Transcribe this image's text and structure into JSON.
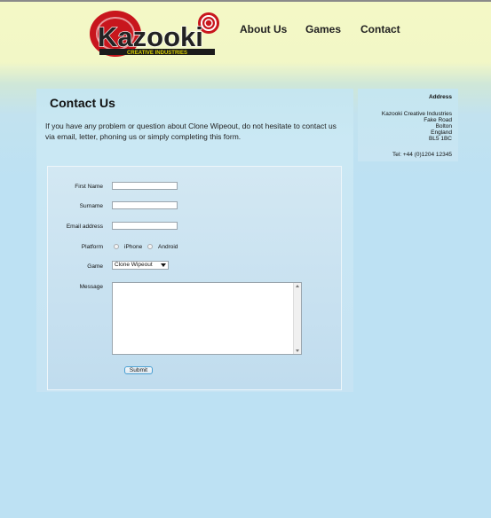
{
  "brand": {
    "logo_text": "Kazooki",
    "logo_subtext": "CREATIVE INDUSTRIES",
    "colors": {
      "logo_red": "#c8161d",
      "logo_dark": "#222222",
      "logo_yellow": "#d8d000"
    }
  },
  "nav": [
    {
      "label": "About Us"
    },
    {
      "label": "Games"
    },
    {
      "label": "Contact"
    }
  ],
  "content": {
    "title": "Contact Us",
    "intro": "If you have any problem or question about Clone Wipeout, do not hesitate to contact us via email, letter, phoning us or simply completing this form."
  },
  "form": {
    "first_name_label": "First Name",
    "first_name_value": "",
    "surname_label": "Surname",
    "surname_value": "",
    "email_label": "Email address",
    "email_value": "",
    "platform_label": "Platform",
    "platform_options": [
      "iPhone",
      "Android"
    ],
    "game_label": "Game",
    "game_selected": "Clone Wipeout",
    "message_label": "Message",
    "message_value": "",
    "submit_label": "Submit"
  },
  "sidebar": {
    "heading": "Address",
    "address_lines": [
      "Kazooki Creative Industries",
      "Fake Road",
      "Bolton",
      "England",
      "BL5 1BC"
    ],
    "tel": "Tel: +44 (0)1204 12345"
  }
}
